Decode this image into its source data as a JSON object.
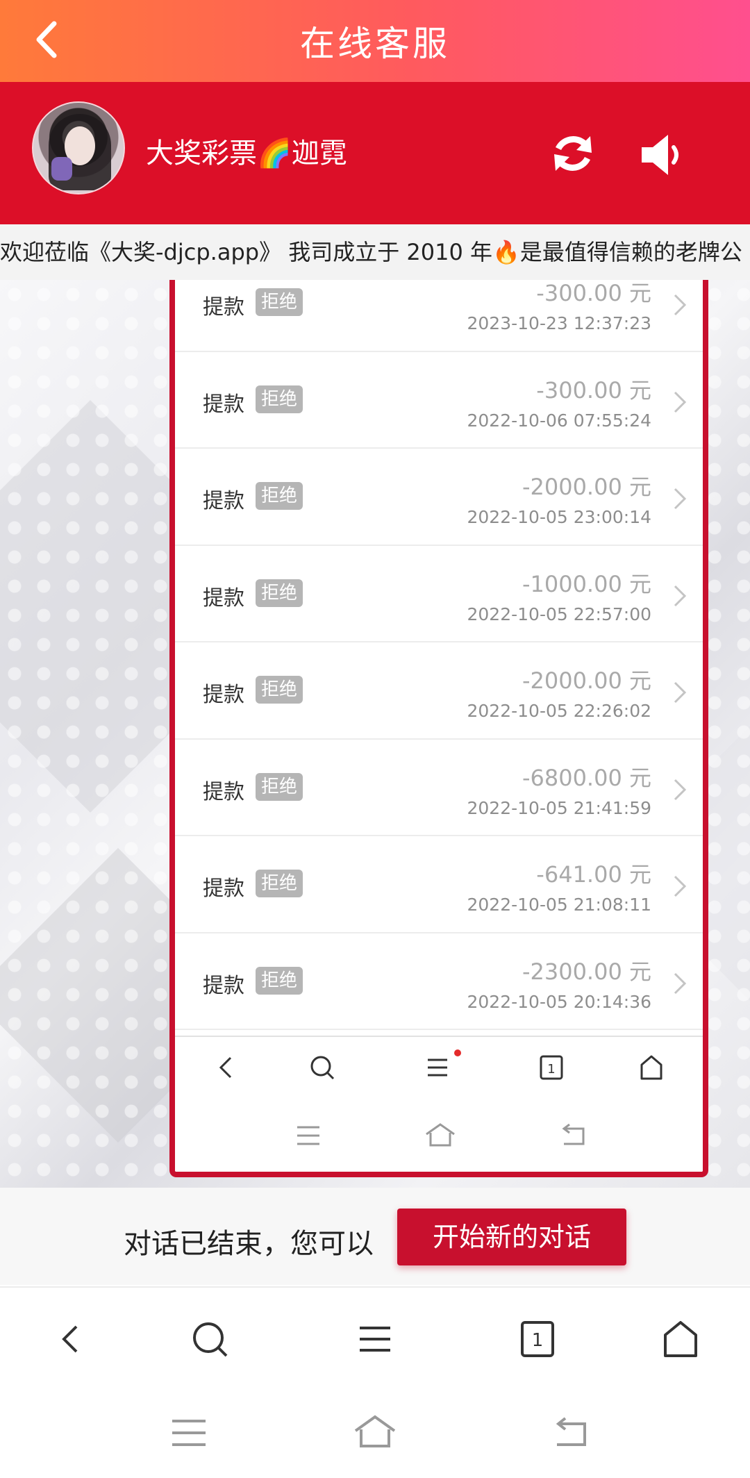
{
  "topbar": {
    "title": "在线客服"
  },
  "agent": {
    "name": "大奖彩票🌈迦霓"
  },
  "marquee": {
    "text": "欢迎莅临《大奖-djcp.app》 我司成立于 2010 年🔥是最值得信赖的老牌公"
  },
  "records": [
    {
      "type": "提款",
      "status": "拒绝",
      "amount": "-300.00 元",
      "time": "2023-10-23 12:37:23"
    },
    {
      "type": "提款",
      "status": "拒绝",
      "amount": "-300.00 元",
      "time": "2022-10-06 07:55:24"
    },
    {
      "type": "提款",
      "status": "拒绝",
      "amount": "-2000.00 元",
      "time": "2022-10-05 23:00:14"
    },
    {
      "type": "提款",
      "status": "拒绝",
      "amount": "-1000.00 元",
      "time": "2022-10-05 22:57:00"
    },
    {
      "type": "提款",
      "status": "拒绝",
      "amount": "-2000.00 元",
      "time": "2022-10-05 22:26:02"
    },
    {
      "type": "提款",
      "status": "拒绝",
      "amount": "-6800.00 元",
      "time": "2022-10-05 21:41:59"
    },
    {
      "type": "提款",
      "status": "拒绝",
      "amount": "-641.00 元",
      "time": "2022-10-05 21:08:11"
    },
    {
      "type": "提款",
      "status": "拒绝",
      "amount": "-2300.00 元",
      "time": "2022-10-05 20:14:36"
    }
  ],
  "shot_nav": {
    "tab_count": "1"
  },
  "ended": {
    "text": "对话已结束，您可以",
    "button": "开始新的对话"
  },
  "bottom_nav": {
    "tab_count": "1"
  },
  "colors": {
    "brand": "#dc0f28",
    "button": "#c8102e"
  }
}
